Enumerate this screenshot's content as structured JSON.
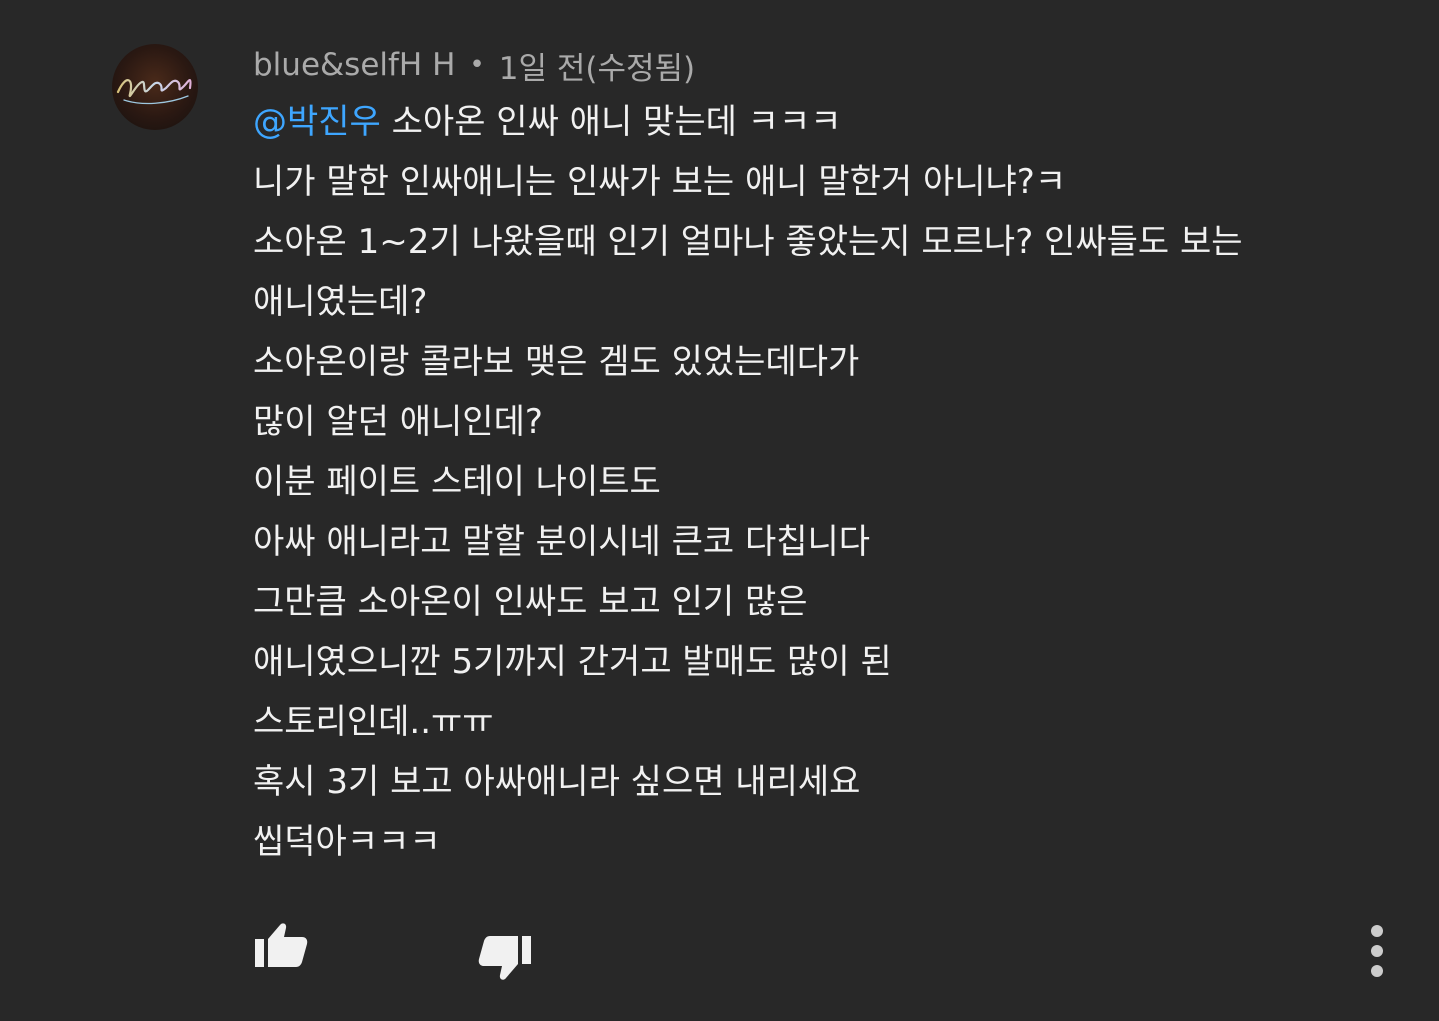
{
  "comment": {
    "avatar_icon": "user-avatar",
    "author": "blue&selfH H",
    "separator": "•",
    "timestamp": "1일 전(수정됨)",
    "mention": "@박진우",
    "first_line_rest": " 소아온 인싸 애니 맞는데 ㅋㅋㅋ",
    "lines": [
      "니가 말한 인싸애니는 인싸가 보는 애니 말한거 아니냐?ㅋ",
      "소아온 1~2기 나왔을때 인기 얼마나 좋았는지 모르나? 인싸들도 보는",
      "애니였는데?",
      "소아온이랑 콜라보 맺은 겜도 있었는데다가",
      "많이 알던 애니인데?",
      "이분 페이트 스테이 나이트도",
      "아싸 애니라고 말할 분이시네 큰코 다칩니다",
      "그만큼 소아온이 인싸도 보고 인기 많은",
      "애니였으니깐 5기까지 간거고 발매도 많이 된",
      "스토리인데..ㅠㅠ",
      "혹시 3기 보고 아싸애니라 싶으면 내리세요",
      "씹덕아ㅋㅋㅋ"
    ]
  },
  "actions": {
    "like_icon": "thumbs-up-icon",
    "dislike_icon": "thumbs-down-icon",
    "menu_icon": "more-vertical-icon"
  },
  "colors": {
    "background": "#282828",
    "text": "#f1f1f1",
    "meta": "#aaaaaa",
    "mention": "#3ea6ff"
  }
}
